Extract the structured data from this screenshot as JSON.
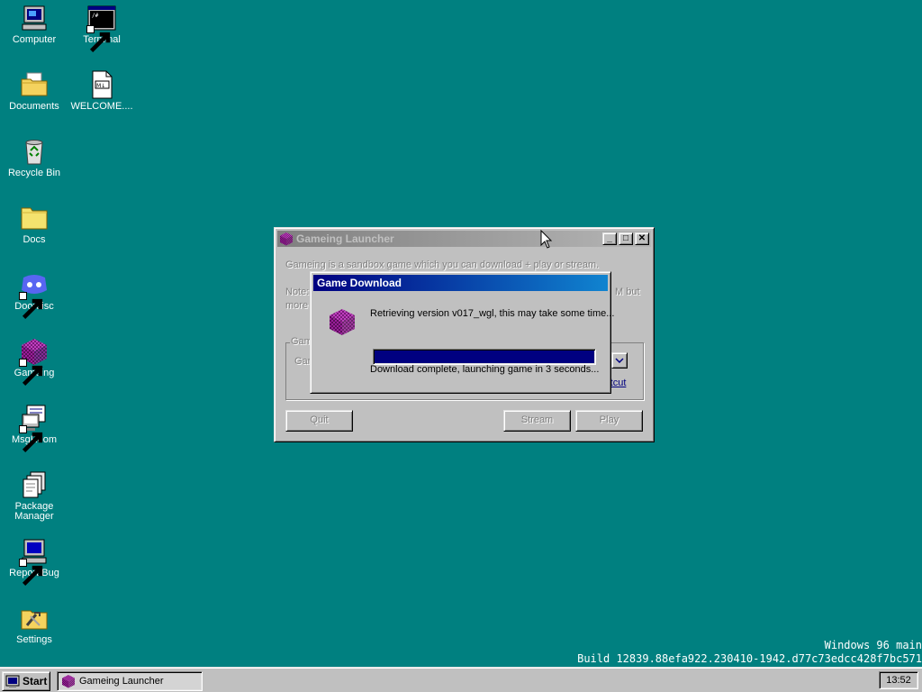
{
  "desktop": {
    "icons": [
      {
        "label": "Computer",
        "icon": "computer-icon"
      },
      {
        "label": "Terminal",
        "icon": "terminal-icon"
      },
      {
        "label": "Documents",
        "icon": "documents-folder-icon"
      },
      {
        "label": "WELCOME....",
        "icon": "markdown-file-icon"
      },
      {
        "label": "Recycle Bin",
        "icon": "recycle-bin-icon"
      },
      {
        "label": "Docs",
        "icon": "folder-icon"
      },
      {
        "label": "Doordisc",
        "icon": "doordisc-icon"
      },
      {
        "label": "Gameing",
        "icon": "gameing-cube-icon"
      },
      {
        "label": "MsgRoom",
        "icon": "msgroom-icon"
      },
      {
        "label": "Package Manager",
        "icon": "package-manager-icon"
      },
      {
        "label": "Report Bug",
        "icon": "report-bug-icon"
      },
      {
        "label": "Settings",
        "icon": "settings-icon"
      }
    ],
    "build_line1": "Windows 96 main",
    "build_line2": "Build 12839.88efa922.230410-1942.d77c73edcc428f7bc571"
  },
  "launcher": {
    "title": "Gameing Launcher",
    "description": "Gameing is a sandbox game which you can download + play or stream.",
    "note_start": "Note:",
    "note_end": "M but",
    "note_line2": "more",
    "group_label": "Gam",
    "game_label": "Gar",
    "shortcut_link": "rtcut",
    "buttons": {
      "quit": "Quit",
      "stream": "Stream",
      "play": "Play"
    },
    "controls": {
      "minimize": "_",
      "maximize": "□",
      "close": "✕"
    }
  },
  "download_dialog": {
    "title": "Game Download",
    "message": "Retrieving version v017_wgl, this may take some time...",
    "status": "Download complete, launching game in 3 seconds...",
    "progress_percent": 100
  },
  "taskbar": {
    "start_label": "Start",
    "task_label": "Gameing Launcher",
    "clock": "13:52"
  },
  "colors": {
    "desktop": "#008080",
    "active_title": "#000080",
    "progress": "#000080",
    "gameing_cube": "#8b1a8b"
  }
}
